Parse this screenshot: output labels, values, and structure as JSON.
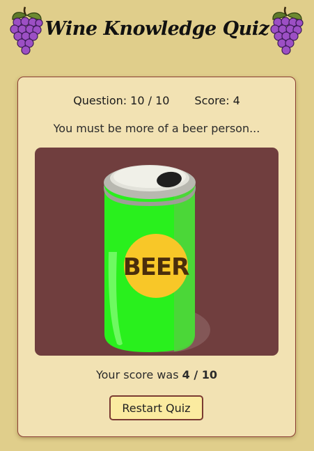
{
  "header": {
    "title": "Wine Knowledge Quiz",
    "left_icon": "grapes-icon",
    "right_icon": "grapes-icon"
  },
  "status": {
    "question_label": "Question:",
    "question_value": "10 / 10",
    "score_label": "Score:",
    "score_value": "4"
  },
  "result": {
    "message": "You must be more of a beer person...",
    "image_icon": "beer-can-icon",
    "can_label": "BEER",
    "score_prefix": "Your score was",
    "score_value": "4 / 10"
  },
  "actions": {
    "restart_label": "Restart Quiz"
  },
  "colors": {
    "page_background": "#e0ce8b",
    "card_background": "#f2e2b3",
    "card_border": "#8b3d33",
    "image_background": "#703e3e",
    "can_green": "#29f01d",
    "can_label_yellow": "#f8c728",
    "button_background": "#fbeba0"
  }
}
